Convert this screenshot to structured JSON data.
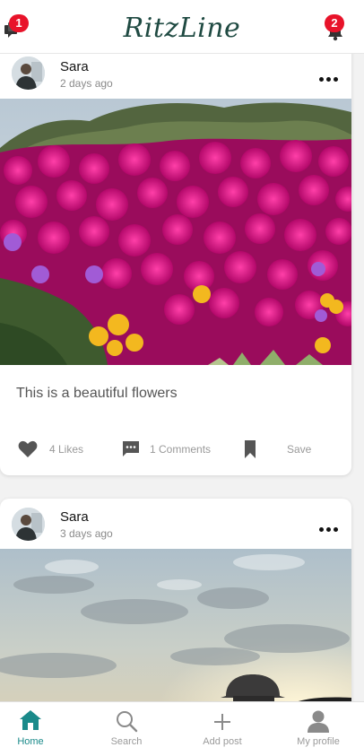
{
  "app": {
    "brand": "RitzLine"
  },
  "header": {
    "messages_badge": "1",
    "notifications_badge": "2"
  },
  "posts": [
    {
      "user": "Sara",
      "time": "2 days ago",
      "caption": "This is a beautiful flowers",
      "likes": "4 Likes",
      "comments": "1 Comments",
      "save": "Save"
    },
    {
      "user": "Sara",
      "time": "3 days ago"
    }
  ],
  "tabs": [
    {
      "label": "Home",
      "icon": "home-icon",
      "active": true
    },
    {
      "label": "Search",
      "icon": "search-icon"
    },
    {
      "label": "Add post",
      "icon": "plus-icon"
    },
    {
      "label": "My profile",
      "icon": "user-icon"
    }
  ],
  "colors": {
    "accent": "#1a8a8a",
    "badge": "#e8132a",
    "brand": "#1f4a42"
  }
}
